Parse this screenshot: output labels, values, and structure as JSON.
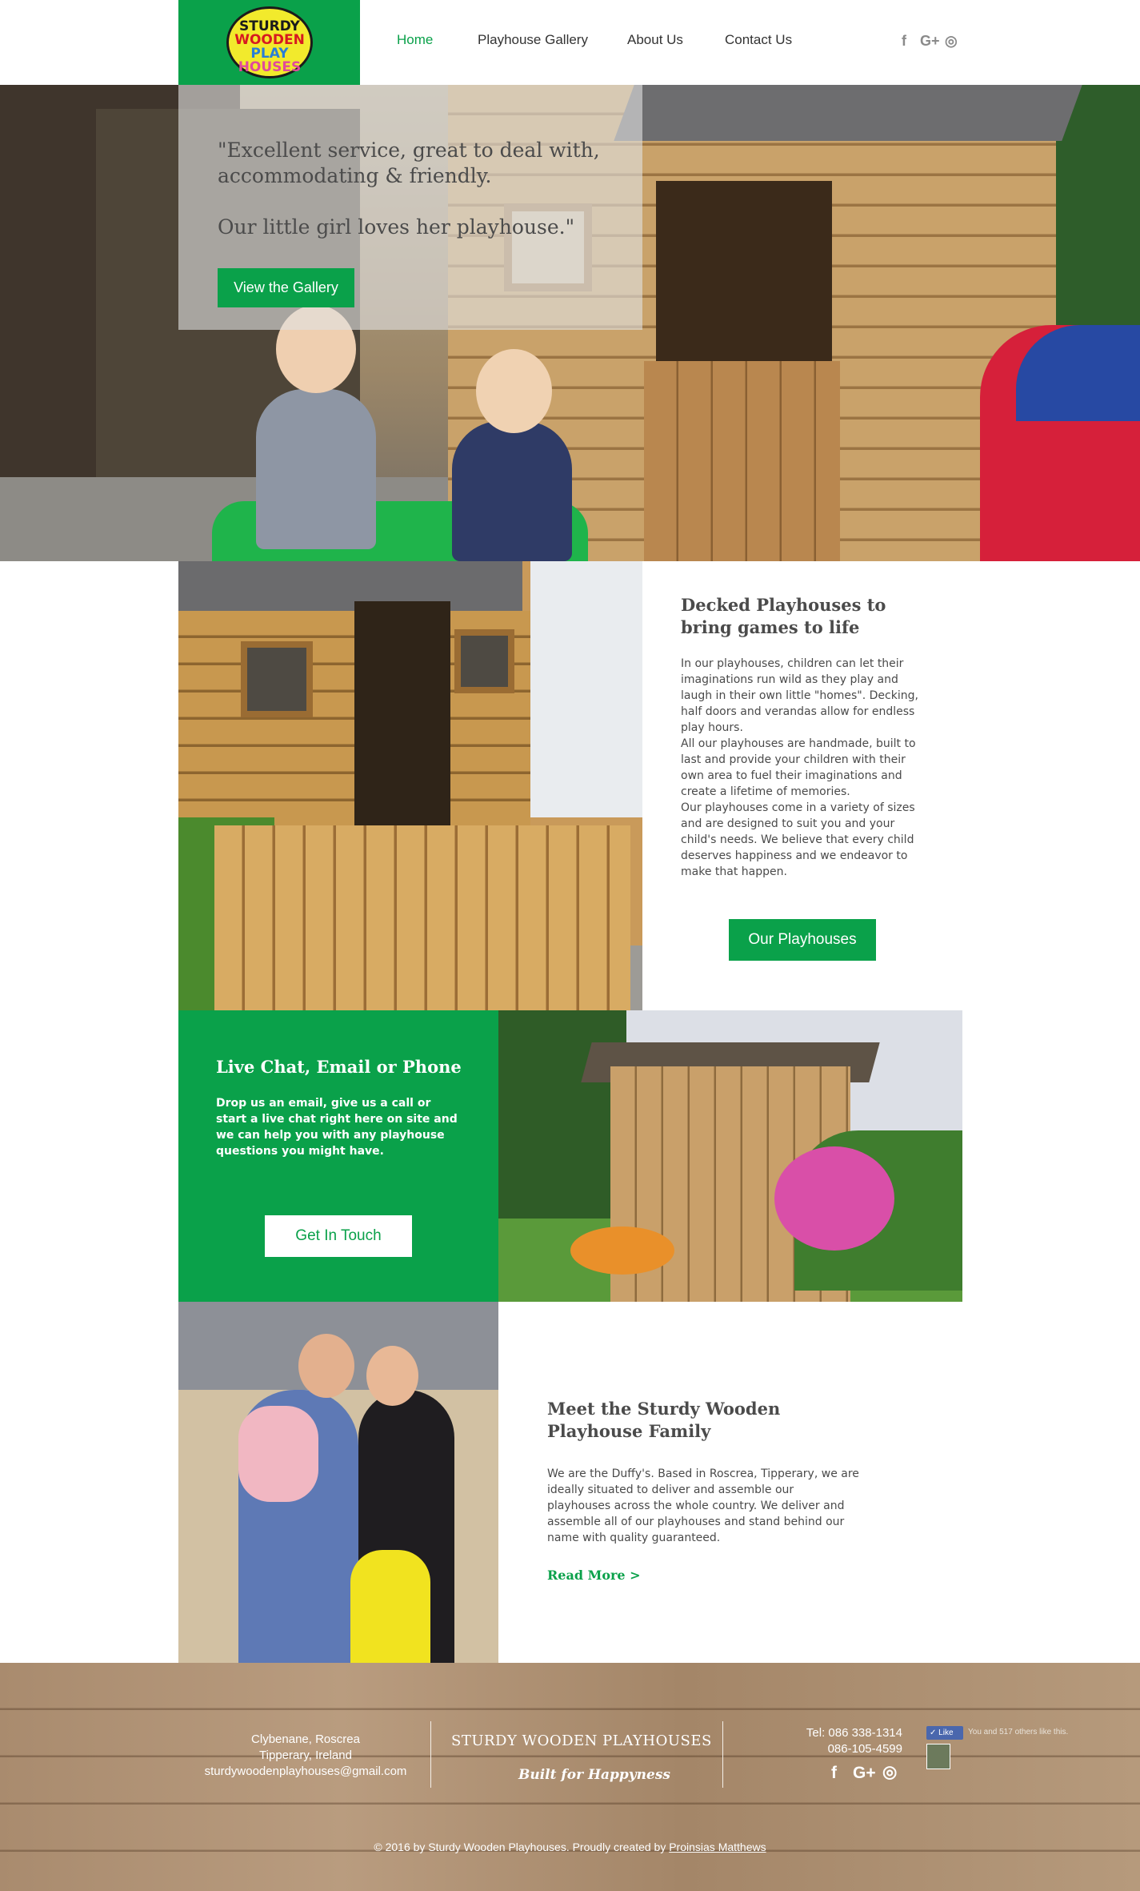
{
  "header": {
    "logo_lines": [
      "STURDY",
      "WOODEN",
      "PLAY",
      "HOUSES"
    ],
    "nav": [
      "Home",
      "Playhouse Gallery",
      "About Us",
      "Contact Us"
    ],
    "social_icons": [
      "facebook-icon",
      "google-plus-icon",
      "instagram-icon"
    ],
    "social_glyphs": [
      "f",
      "G+",
      "◎"
    ],
    "accent_color": "#0aa14a"
  },
  "hero": {
    "quote_line1": "\"Excellent service, great to deal with, accommodating & friendly.",
    "quote_line2": "Our little girl loves her playhouse.\"",
    "button": "View the Gallery"
  },
  "decked": {
    "title": "Decked Playhouses to bring games to life",
    "paragraph1": "In our playhouses, children can let their imaginations run wild as they play and laugh in their own little \"homes\". Decking, half doors and verandas allow for endless play hours.",
    "paragraph2": "All our playhouses are handmade, built to last and provide your children with their own area to fuel their imaginations and create a lifetime of memories.",
    "paragraph3": "Our playhouses come in a variety of sizes and are designed to suit you and your child's needs. We believe that every child deserves happiness and we endeavor to make that happen.",
    "button": "Our Playhouses"
  },
  "contact": {
    "title": "Live Chat, Email or Phone",
    "text": "Drop us an email, give us a call or start a live chat right here on site and we can help you with any playhouse questions you might have.",
    "button": "Get In Touch"
  },
  "family": {
    "title": "Meet the Sturdy Wooden Playhouse Family",
    "text": "We are the Duffy's. Based in Roscrea, Tipperary, we are ideally situated to deliver and assemble our playhouses across the whole country. We deliver and assemble all of our playhouses and stand behind our name with quality guaranteed.",
    "link": "Read More >"
  },
  "footer": {
    "address_line1": "Clybenane, Roscrea",
    "address_line2": "Tipperary, Ireland",
    "email": "sturdywoodenplayhouses@gmail.com",
    "brand": "STURDY WOODEN PLAYHOUSES",
    "tagline": "Built for Happyness",
    "phone1": "Tel: 086 338-1314",
    "phone2": "086-105-4599",
    "social_glyphs": [
      "f",
      "G+",
      "◎"
    ],
    "fb_like": "✓ Like",
    "fb_text": "You and 517 others like this.",
    "copyright_prefix": "© 2016 by Sturdy Wooden Playhouses. Proudly created by ",
    "copyright_link": "Proinsias Matthews"
  }
}
